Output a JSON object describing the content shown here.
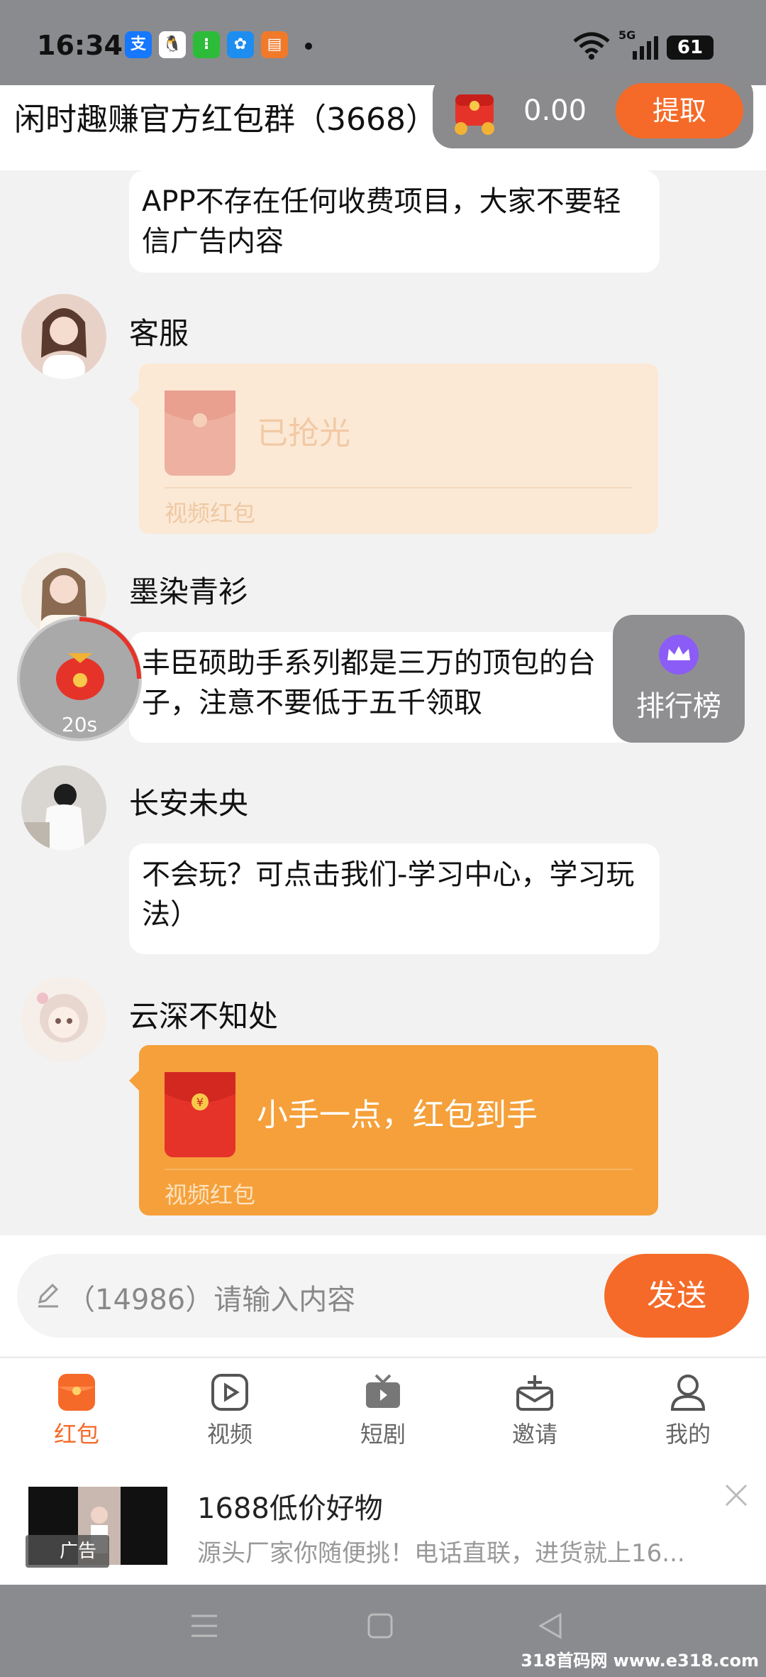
{
  "status_bar": {
    "time": "16:34",
    "network": "5G",
    "battery": "61"
  },
  "header": {
    "title": "闲时趣赚官方红包群（3668）"
  },
  "wallet": {
    "amount": "0.00",
    "withdraw_label": "提取"
  },
  "messages": [
    {
      "text": "APP不存在任何收费项目，大家不要轻信广告内容"
    },
    {
      "sender": "客服",
      "redpacket_title": "已抢光",
      "redpacket_type": "视频红包"
    },
    {
      "sender": "墨染青衫",
      "text": "丰臣硕助手系列都是三万的顶包的台子，注意不要低于五千领取"
    },
    {
      "sender": "长安未央",
      "text": "不会玩？可点击我们-学习中心，学习玩法）"
    },
    {
      "sender": "云深不知处",
      "redpacket_title": "小手一点，红包到手",
      "redpacket_type": "视频红包"
    }
  ],
  "floating": {
    "timer": "20s",
    "ranking_label": "排行榜"
  },
  "input": {
    "placeholder": "（14986）请输入内容",
    "send_label": "发送"
  },
  "nav": [
    {
      "label": "红包",
      "active": true
    },
    {
      "label": "视频"
    },
    {
      "label": "短剧"
    },
    {
      "label": "邀请"
    },
    {
      "label": "我的"
    }
  ],
  "ad": {
    "title": "1688低价好物",
    "description": "源头厂家你随便挑！电话直联，进货就上16...",
    "tag": "广告"
  },
  "watermark": "318首码网 www.e318.com",
  "colors": {
    "accent": "#f56a28",
    "redpacket": "#f5a03a",
    "redpacket_opened": "#fbe9d6"
  }
}
